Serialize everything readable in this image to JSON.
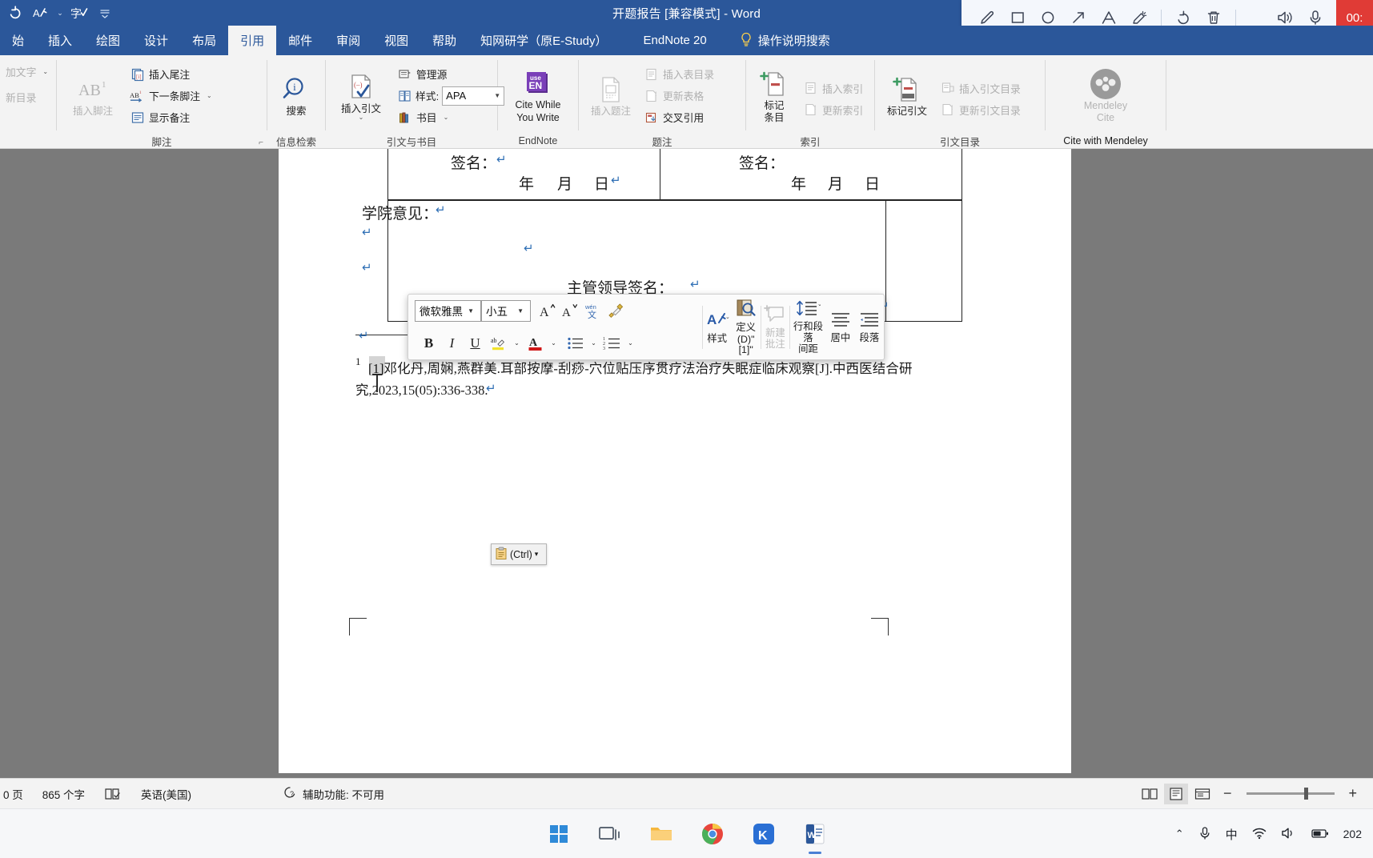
{
  "titlebar": {
    "document_title": "开题报告 [兼容模式]  -  Word",
    "qat": [
      {
        "name": "undo-icon",
        "glyph": "↺"
      },
      {
        "name": "autosave-icon",
        "glyph": "A"
      },
      {
        "name": "spellcheck-icon",
        "glyph": "字"
      },
      {
        "name": "customize-qat-icon",
        "glyph": "⌄"
      }
    ]
  },
  "recorder": {
    "tools": [
      {
        "name": "pen-tool-icon",
        "glyph": "✎"
      },
      {
        "name": "rectangle-tool-icon",
        "glyph": "▢"
      },
      {
        "name": "ellipse-tool-icon",
        "glyph": "◯"
      },
      {
        "name": "arrow-tool-icon",
        "glyph": "↗"
      },
      {
        "name": "text-tool-icon",
        "glyph": "A"
      },
      {
        "name": "highlighter-tool-icon",
        "glyph": "✨"
      },
      {
        "name": "undo-icon",
        "glyph": "↺"
      },
      {
        "name": "delete-icon",
        "glyph": "🗑"
      },
      {
        "name": "speaker-icon",
        "glyph": "🔊"
      },
      {
        "name": "microphone-icon",
        "glyph": "🎤"
      },
      {
        "name": "close-icon",
        "glyph": "✕"
      }
    ],
    "timer": "00:"
  },
  "ribbon": {
    "tabs": [
      {
        "label": "始",
        "active": false
      },
      {
        "label": "插入",
        "active": false
      },
      {
        "label": "绘图",
        "active": false
      },
      {
        "label": "设计",
        "active": false
      },
      {
        "label": "布局",
        "active": false
      },
      {
        "label": "引用",
        "active": true
      },
      {
        "label": "邮件",
        "active": false
      },
      {
        "label": "审阅",
        "active": false
      },
      {
        "label": "视图",
        "active": false
      },
      {
        "label": "帮助",
        "active": false
      },
      {
        "label": "知网研学（原E-Study）",
        "active": false
      },
      {
        "label": "EndNote 20",
        "active": false
      }
    ],
    "tellme": "操作说明搜索",
    "groups": {
      "toc": {
        "label": "",
        "items": [
          {
            "label": "加文字",
            "chev": "⌄",
            "disabled": true
          },
          {
            "label": "新目录",
            "chev": "",
            "disabled": true
          }
        ]
      },
      "footnotes": {
        "label": "脚注",
        "insert_footnote": "插入脚注",
        "items": [
          {
            "label": "插入尾注",
            "icon": "insert-endnote-icon",
            "disabled": false,
            "chev": ""
          },
          {
            "label": "下一条脚注",
            "icon": "next-footnote-icon",
            "disabled": false,
            "chev": "⌄"
          },
          {
            "label": "显示备注",
            "icon": "show-notes-icon",
            "disabled": false,
            "chev": ""
          }
        ]
      },
      "research": {
        "label": "信息检索",
        "button": "搜索"
      },
      "citations": {
        "label": "引文与书目",
        "insert_citation": "插入引文",
        "manage_sources": "管理源",
        "style_label": "样式:",
        "style_value": "APA",
        "bibliography": "书目"
      },
      "endnote": {
        "label": "EndNote",
        "cite_while_you_write": "Cite While You Write",
        "badge_top": "use",
        "badge_bottom": "EN"
      },
      "captions": {
        "label": "题注",
        "insert_caption": "插入题注",
        "items": [
          {
            "label": "插入表目录",
            "disabled": true
          },
          {
            "label": "更新表格",
            "disabled": true
          },
          {
            "label": "交叉引用",
            "disabled": false
          }
        ]
      },
      "index": {
        "label": "索引",
        "mark_entry": "标记 条目",
        "mark_entry_l1": "标记",
        "mark_entry_l2": "条目",
        "items": [
          {
            "label": "插入索引",
            "disabled": true
          },
          {
            "label": "更新索引",
            "disabled": true
          }
        ]
      },
      "authorities": {
        "label": "引文目录",
        "mark_citation_l1": "标记引文",
        "items": [
          {
            "label": "插入引文目录",
            "disabled": true
          },
          {
            "label": "更新引文目录",
            "disabled": true
          }
        ]
      },
      "mendeley": {
        "label": "Cite with Mendeley",
        "button_l1": "Mendeley",
        "button_l2": "Cite"
      }
    }
  },
  "document": {
    "signature_left": "签名：",
    "signature_right": "签名：",
    "date_year": "年",
    "date_month": "月",
    "date_day": "日",
    "college_opinion": "学院意见：",
    "leader_signature": "主管领导签名：",
    "footnote_number": "1",
    "footnote_line1": "[1]邓化丹,周娴,燕群美.耳部按摩-刮痧-穴位贴压序贯疗法治疗失眠症临床观察[J].中西医结合研",
    "footnote_line2": "究,2023,15(05):336-338.",
    "pilcrow": "↵"
  },
  "mini_toolbar": {
    "font_name": "微软雅黑",
    "font_size": "小五",
    "grow_font": "A",
    "shrink_font": "A",
    "phonetic": "wén 文",
    "format_painter": "format-painter-icon",
    "bold": "B",
    "italic": "I",
    "underline": "U",
    "highlight": "ab",
    "font_color": "A",
    "bullets": "bullets-icon",
    "numbering": "numbering-icon",
    "style_l1": "样式",
    "define_l1": "定义",
    "define_l2": "(D)\"[1]\"",
    "newcomment_l1": "新建",
    "newcomment_l2": "批注",
    "linespacing_l1": "行和段落",
    "linespacing_l2": "间距",
    "center_l1": "居中",
    "paragraph_l1": "段落"
  },
  "paste_tag": {
    "label": "(Ctrl)",
    "chev": "▾"
  },
  "statusbar": {
    "pages": "0 页",
    "words": "865 个字",
    "proofing_icon": "proofing-icon",
    "language": "英语(美国)",
    "accessibility": "辅助功能: 不可用",
    "views": [
      {
        "name": "read-mode-icon",
        "glyph": "▤",
        "active": false
      },
      {
        "name": "print-layout-icon",
        "glyph": "▤",
        "active": true
      },
      {
        "name": "web-layout-icon",
        "glyph": "▤",
        "active": false
      }
    ],
    "zoom_out": "−",
    "zoom_in": "+"
  },
  "taskbar": {
    "icons": [
      {
        "name": "start-windows-icon",
        "glyph": ""
      },
      {
        "name": "task-view-icon",
        "glyph": "▭"
      },
      {
        "name": "file-explorer-icon",
        "glyph": "📁"
      },
      {
        "name": "chrome-icon",
        "glyph": "◉"
      },
      {
        "name": "kingsoft-icon",
        "glyph": "K"
      },
      {
        "name": "word-icon",
        "glyph": "W"
      }
    ],
    "tray": {
      "expand": "⌃",
      "mic": "🎤",
      "ime": "中",
      "wifi": "◥",
      "volume": "🔊",
      "battery": "▮",
      "clock": "202"
    }
  }
}
